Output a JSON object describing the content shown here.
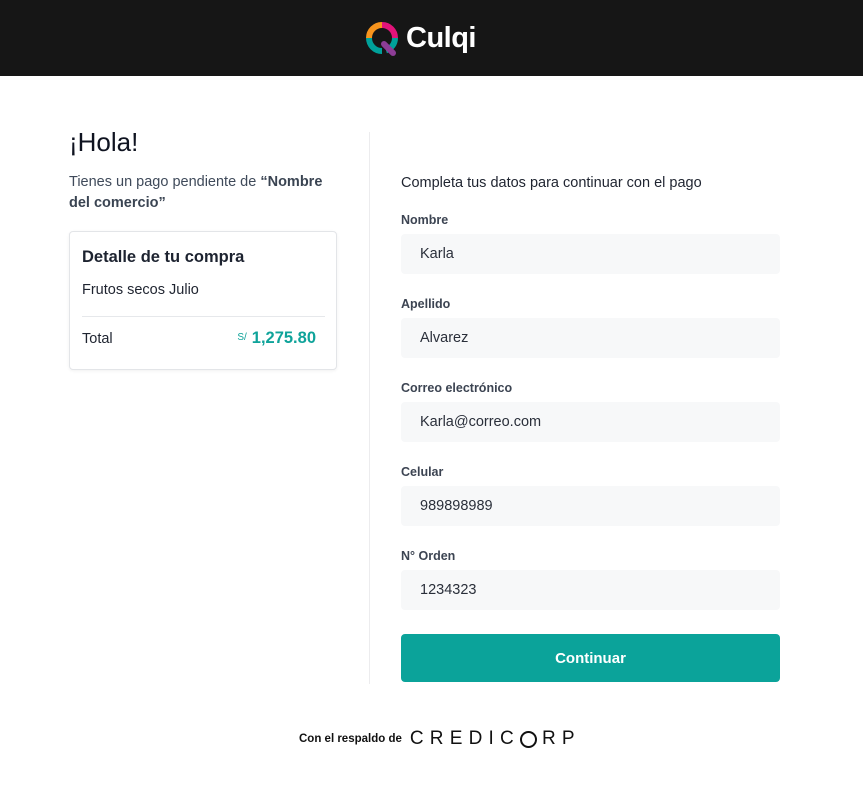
{
  "header": {
    "brand_name": "Culqi",
    "logo_icon": "culqi-q-logo-icon",
    "logo_colors": [
      "#f7941d",
      "#e2137a",
      "#00a19a",
      "#8d3d96"
    ]
  },
  "intro": {
    "greeting": "¡Hola!",
    "pending_prefix": "Tienes un pago pendiente de ",
    "merchant_name": "“Nombre del comercio”"
  },
  "purchase": {
    "title": "Detalle de tu compra",
    "item": "Frutos secos Julio",
    "total_label": "Total",
    "currency": "S/",
    "amount": "1,275.80"
  },
  "form": {
    "intro": "Completa tus datos para continuar con el pago",
    "fields": [
      {
        "label": "Nombre",
        "value": "Karla"
      },
      {
        "label": "Apellido",
        "value": "Alvarez"
      },
      {
        "label": "Correo electrónico",
        "value": "Karla@correo.com"
      },
      {
        "label": "Celular",
        "value": "989898989"
      },
      {
        "label": "N° Orden",
        "value": "1234323"
      }
    ],
    "submit_label": "Continuar"
  },
  "footer": {
    "backed_by": "Con el respaldo de",
    "partner_pre": "CREDIC",
    "partner_post": "RP"
  },
  "colors": {
    "accent": "#0ba39a",
    "topbar": "#161616",
    "input_bg": "#f7f8f9"
  }
}
